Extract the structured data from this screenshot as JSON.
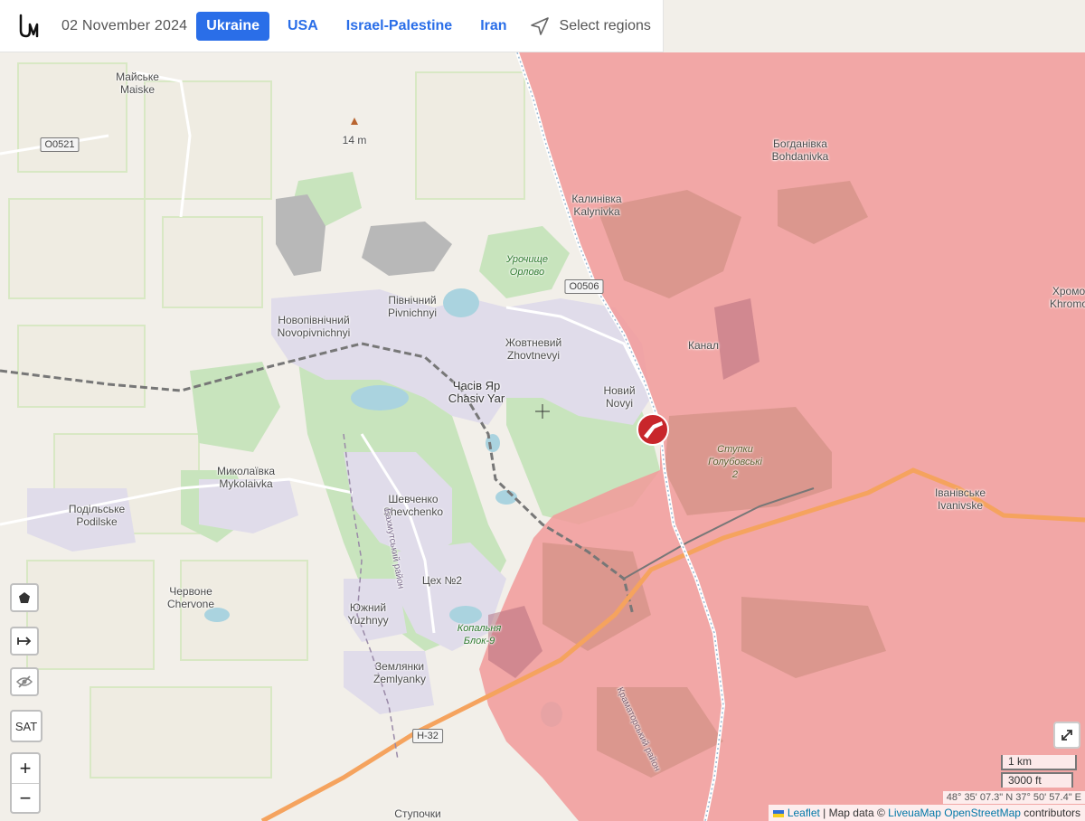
{
  "header": {
    "date": "02 November 2024",
    "tabs": [
      {
        "label": "Ukraine",
        "active": true
      },
      {
        "label": "USA",
        "active": false
      },
      {
        "label": "Israel-Palestine",
        "active": false
      },
      {
        "label": "Iran",
        "active": false
      }
    ],
    "select_regions_label": "Select regions"
  },
  "map": {
    "places": {
      "maiske": "Майське\nMaiske",
      "peak": "14 m",
      "bohdanivka": "Богданівка\nBohdanivka",
      "kalynivka": "Калинівка\nKalynivka",
      "orlovo": "Урочище\nОрлово",
      "pivnichnyi": "Північний\nPivnichnyi",
      "novopivnichnyi": "Новопівнічний\nNovopivnichnyi",
      "zhovtnevyi": "Жовтневий\nZhovtnevyi",
      "chasiv_yar": "Часів Яр\nChasiv Yar",
      "novyi": "Новий\nNovyi",
      "kanal": "Канал",
      "khromove": "Хромо\nKhromo",
      "stupky": "Ступки\nГолубовські\n2",
      "mykolaivka": "Миколаївка\nMykolaivka",
      "podilske": "Подільське\nPodilske",
      "shevchenko": "Шевченко\nShevchenko",
      "ivanivske": "Іванівське\nIvanivske",
      "tsekh": "Цех №2",
      "chervone": "Червоне\nChervone",
      "yuzhnyi": "Южний\nYuzhnyy",
      "kopalnia": "Копальня\nБлок-9",
      "zemlianky": "Землянки\nZemlyanky",
      "stupochky": "Ступочки",
      "district_bakhmut": "Бахмутський район",
      "district_kramatorsk": "Краматорський район"
    },
    "road_labels": {
      "o0521": "O0521",
      "o0506": "O0506",
      "h32": "H-32"
    },
    "colors": {
      "occupied": "#f29a9a",
      "forest": "#c8e4bd",
      "urban": "#e0dcea",
      "water": "#aad3df",
      "primary_road": "#f5a35e"
    }
  },
  "controls": {
    "polygon_icon": "pentagon-icon",
    "measure_icon": "arrow-right-to-bar-icon",
    "hide_icon": "eye-slash-icon",
    "sat_label": "SAT",
    "zoom_in": "+",
    "zoom_out": "−"
  },
  "scale": {
    "km": "1 km",
    "ft": "3000 ft"
  },
  "coords": "48° 35' 07.3\" N 37° 50' 57.4\" E",
  "attribution": {
    "leaflet": "Leaflet",
    "sep1": " | Map data © ",
    "liveuamap": "LiveuaMap",
    "osm": "OpenStreetMap",
    "contributors": "contributors"
  }
}
